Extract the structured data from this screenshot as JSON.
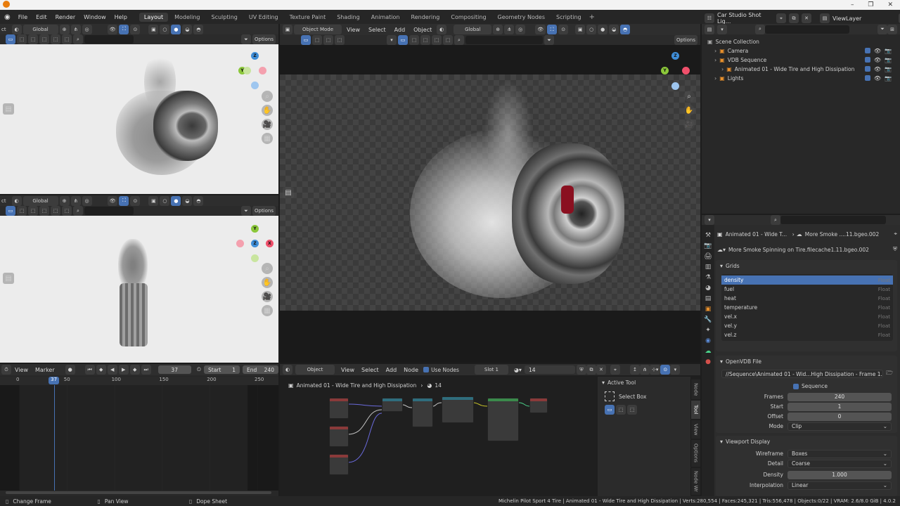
{
  "menu": [
    "File",
    "Edit",
    "Render",
    "Window",
    "Help"
  ],
  "workspaces": [
    "Layout",
    "Modeling",
    "Sculpting",
    "UV Editing",
    "Texture Paint",
    "Shading",
    "Animation",
    "Rendering",
    "Compositing",
    "Geometry Nodes",
    "Scripting"
  ],
  "workspace_add": "+",
  "scene": {
    "name": "Car Studio Shot Lig...",
    "viewlayer": "ViewLayer"
  },
  "viewport": {
    "mode": "Object Mode",
    "menus": [
      "View",
      "Select",
      "Add",
      "Object"
    ],
    "orientation": "Global",
    "options": "Options",
    "small_partial_label": "ct"
  },
  "gizmo_axes": {
    "x": "X",
    "y": "Y",
    "z": "Z"
  },
  "outliner": {
    "title": "Scene Collection",
    "items": [
      {
        "label": "Camera",
        "indent": 1
      },
      {
        "label": "VDB Sequence",
        "indent": 1
      },
      {
        "label": "Animated 01 - Wide Tire and High Dissipation",
        "indent": 2
      },
      {
        "label": "Lights",
        "indent": 1
      }
    ]
  },
  "properties": {
    "breadcrumb1": "Animated 01 - Wide T...",
    "breadcrumb2": "More Smoke ....11.bgeo.002",
    "data_name": "More Smoke Spinning on Tire.filecache1.11.bgeo.002",
    "grids_title": "Grids",
    "grids": [
      {
        "name": "density",
        "type": "Float"
      },
      {
        "name": "fuel",
        "type": "Float"
      },
      {
        "name": "heat",
        "type": "Float"
      },
      {
        "name": "temperature",
        "type": "Float"
      },
      {
        "name": "vel.x",
        "type": "Float"
      },
      {
        "name": "vel.y",
        "type": "Float"
      },
      {
        "name": "vel.z",
        "type": "Float"
      }
    ],
    "openvdb_title": "OpenVDB File",
    "filepath": "//Sequence\\Animated 01 - Wid...High Dissipation - Frame 1.vdb",
    "sequence_label": "Sequence",
    "frames_label": "Frames",
    "frames": "240",
    "start_label": "Start",
    "start": "1",
    "offset_label": "Offset",
    "offset": "0",
    "mode_label": "Mode",
    "mode": "Clip",
    "vpdisplay_title": "Viewport Display",
    "wireframe_label": "Wireframe",
    "wireframe": "Boxes",
    "detail_label": "Detail",
    "detail": "Coarse",
    "density_label": "Density",
    "density": "1.000",
    "interp_label": "Interpolation",
    "interp": "Linear"
  },
  "timeline": {
    "menus": [
      "View",
      "Marker"
    ],
    "current_frame": "37",
    "start_label": "Start",
    "start": "1",
    "end_label": "End",
    "end": "240",
    "ticks": [
      "0",
      "50",
      "100",
      "150",
      "200",
      "250"
    ],
    "playhead": "37"
  },
  "node_editor": {
    "type": "Object",
    "menus": [
      "View",
      "Select",
      "Add",
      "Node"
    ],
    "use_nodes": "Use Nodes",
    "slot": "Slot 1",
    "material_users": "14",
    "breadcrumb": "Animated 01 - Wide Tire and High Dissipation",
    "breadcrumb_users": "14"
  },
  "tool_panel": {
    "title": "Active Tool",
    "tool": "Select Box",
    "tabs": [
      "Node",
      "Tool",
      "View",
      "Options",
      "Node Wr"
    ]
  },
  "statusbar": {
    "left": [
      {
        "label": "Change Frame"
      },
      {
        "label": "Pan View"
      },
      {
        "label": "Dope Sheet"
      }
    ],
    "right": "Michelin Pilot Sport 4 Tire | Animated 01 - Wide Tire and High Dissipation | Verts:280,554 | Faces:245,321 | Tris:556,478 | Objects:0/22 | VRAM: 2.6/8.0 GiB | 4.0.2"
  },
  "colors": {
    "accent": "#4772b3",
    "x": "#f0506b",
    "y": "#8bc73a",
    "z": "#3f8ed8",
    "playhead": "#4772b3"
  }
}
